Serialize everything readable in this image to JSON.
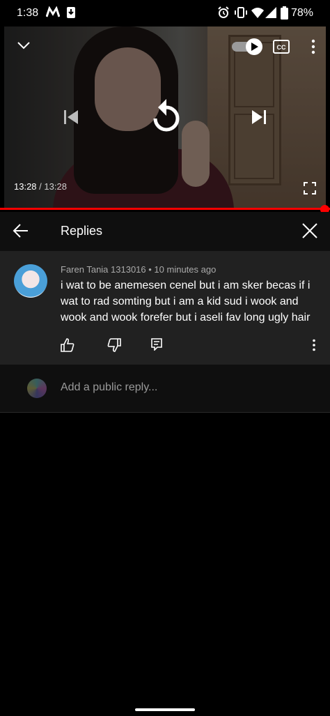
{
  "status_bar": {
    "time": "1:38",
    "battery": "78%"
  },
  "video": {
    "current_time": "13:28",
    "separator": " / ",
    "duration": "13:28"
  },
  "replies_panel": {
    "title": "Replies"
  },
  "comment": {
    "author": "Faren Tania 1313016",
    "age": "10 minutes ago",
    "text": "i wat to be anemesen cenel but i am sker becas if i wat to rad somting but i am a kid sud i wook and wook and wook forefer but i aseli fav long ugly hair"
  },
  "reply_box": {
    "placeholder": "Add a public reply..."
  },
  "colors": {
    "accent": "#ff0000",
    "panel": "#212121",
    "header": "#0f0f0f"
  }
}
